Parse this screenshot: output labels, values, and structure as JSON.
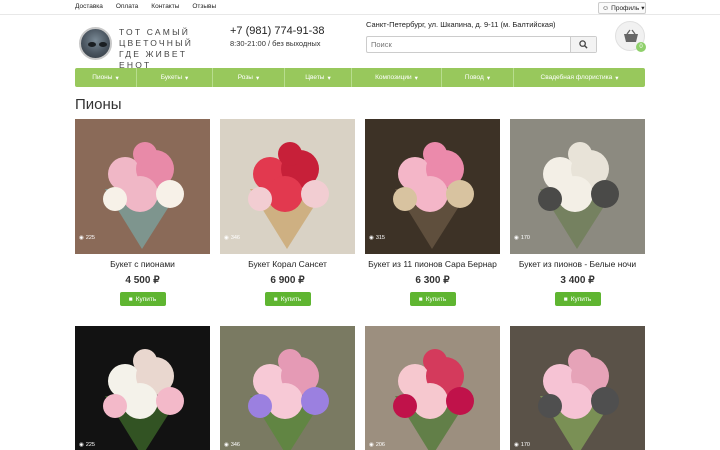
{
  "topnav": [
    "Доставка",
    "Оплата",
    "Контакты",
    "Отзывы"
  ],
  "profile_label": "Профиль",
  "logo_lines": [
    "ТОТ САМЫЙ",
    "ЦВЕТОЧНЫЙ",
    "ГДЕ ЖИВЕТ ЕНОТ"
  ],
  "phone": "+7 (981) 774-91-38",
  "hours": "8:30-21:00 / без выходных",
  "address": "Санкт-Петербург, ул. Шкапина, д. 9-11 (м. Балтийская)",
  "search_placeholder": "Поиск",
  "cart_count": "0",
  "menu": [
    {
      "label": "Пионы",
      "w": 62
    },
    {
      "label": "Букеты",
      "w": 76
    },
    {
      "label": "Розы",
      "w": 72
    },
    {
      "label": "Цветы",
      "w": 67
    },
    {
      "label": "Композиции",
      "w": 90
    },
    {
      "label": "Повод",
      "w": 72
    },
    {
      "label": "Свадебная флористика",
      "w": 131
    }
  ],
  "page_title": "Пионы",
  "buy_label": "Купить",
  "products": [
    {
      "name": "Букет с пионами",
      "price": "4 500 ₽",
      "views": "225"
    },
    {
      "name": "Букет Корал Сансет",
      "price": "6 900 ₽",
      "views": "346"
    },
    {
      "name": "Букет из 11 пионов Сара Бернар",
      "price": "6 300 ₽",
      "views": "315"
    },
    {
      "name": "Букет из пионов - Белые ночи",
      "price": "3 400 ₽",
      "views": "170"
    },
    {
      "views": "225"
    },
    {
      "views": "346"
    },
    {
      "views": "206"
    },
    {
      "views": "170"
    }
  ],
  "colors": {
    "accent": "#98c85c",
    "buy": "#5fb531"
  }
}
